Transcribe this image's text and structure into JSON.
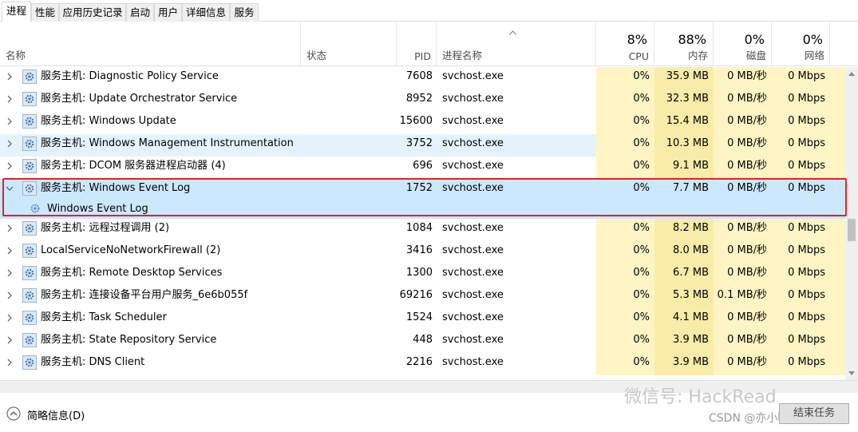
{
  "tabs": [
    "进程",
    "性能",
    "应用历史记录",
    "启动",
    "用户",
    "详细信息",
    "服务"
  ],
  "header": {
    "name": "名称",
    "status": "状态",
    "pid": "PID",
    "process_name": "进程名称",
    "cpu_pct": "8%",
    "cpu": "CPU",
    "mem_pct": "88%",
    "mem": "内存",
    "disk_pct": "0%",
    "disk": "磁盘",
    "net_pct": "0%",
    "net": "网络"
  },
  "rows": [
    {
      "name": "服务主机: Diagnostic Policy Service",
      "pid": "7608",
      "proc": "svchost.exe",
      "cpu": "0%",
      "mem": "35.9 MB",
      "disk": "0 MB/秒",
      "net": "0 Mbps"
    },
    {
      "name": "服务主机: Update Orchestrator Service",
      "pid": "8952",
      "proc": "svchost.exe",
      "cpu": "0%",
      "mem": "32.3 MB",
      "disk": "0 MB/秒",
      "net": "0 Mbps"
    },
    {
      "name": "服务主机: Windows Update",
      "pid": "15600",
      "proc": "svchost.exe",
      "cpu": "0%",
      "mem": "15.4 MB",
      "disk": "0 MB/秒",
      "net": "0 Mbps"
    },
    {
      "name": "服务主机: Windows Management Instrumentation",
      "pid": "3752",
      "proc": "svchost.exe",
      "cpu": "0%",
      "mem": "10.3 MB",
      "disk": "0 MB/秒",
      "net": "0 Mbps"
    },
    {
      "name": "服务主机: DCOM 服务器进程启动器 (4)",
      "pid": "696",
      "proc": "svchost.exe",
      "cpu": "0%",
      "mem": "9.1 MB",
      "disk": "0 MB/秒",
      "net": "0 Mbps"
    },
    {
      "name": "服务主机: Windows Event Log",
      "pid": "1752",
      "proc": "svchost.exe",
      "cpu": "0%",
      "mem": "7.7 MB",
      "disk": "0 MB/秒",
      "net": "0 Mbps",
      "child": "Windows Event Log"
    },
    {
      "name": "服务主机: 远程过程调用 (2)",
      "pid": "1084",
      "proc": "svchost.exe",
      "cpu": "0%",
      "mem": "8.2 MB",
      "disk": "0 MB/秒",
      "net": "0 Mbps"
    },
    {
      "name": "LocalServiceNoNetworkFirewall (2)",
      "pid": "3416",
      "proc": "svchost.exe",
      "cpu": "0%",
      "mem": "8.0 MB",
      "disk": "0 MB/秒",
      "net": "0 Mbps"
    },
    {
      "name": "服务主机: Remote Desktop Services",
      "pid": "1300",
      "proc": "svchost.exe",
      "cpu": "0%",
      "mem": "6.7 MB",
      "disk": "0 MB/秒",
      "net": "0 Mbps"
    },
    {
      "name": "服务主机: 连接设备平台用户服务_6e6b055f",
      "pid": "69216",
      "proc": "svchost.exe",
      "cpu": "0%",
      "mem": "5.3 MB",
      "disk": "0.1 MB/秒",
      "net": "0 Mbps"
    },
    {
      "name": "服务主机: Task Scheduler",
      "pid": "1524",
      "proc": "svchost.exe",
      "cpu": "0%",
      "mem": "4.1 MB",
      "disk": "0 MB/秒",
      "net": "0 Mbps"
    },
    {
      "name": "服务主机: State Repository Service",
      "pid": "448",
      "proc": "svchost.exe",
      "cpu": "0%",
      "mem": "3.9 MB",
      "disk": "0 MB/秒",
      "net": "0 Mbps"
    },
    {
      "name": "服务主机: DNS Client",
      "pid": "2216",
      "proc": "svchost.exe",
      "cpu": "0%",
      "mem": "3.9 MB",
      "disk": "0 MB/秒",
      "net": "0 Mbps"
    }
  ],
  "footer": {
    "fewer_details": "简略信息(D)",
    "end_task": "结束任务"
  },
  "watermark": {
    "wechat": "微信号: HackRead",
    "csdn": "CSDN @亦小明兄"
  },
  "colors": {
    "highlight": "#cce8ff",
    "hover": "#e5f3ff",
    "heat": "#fff4c4",
    "heat_strong": "#f9eca8",
    "annotation": "#e8211f"
  }
}
